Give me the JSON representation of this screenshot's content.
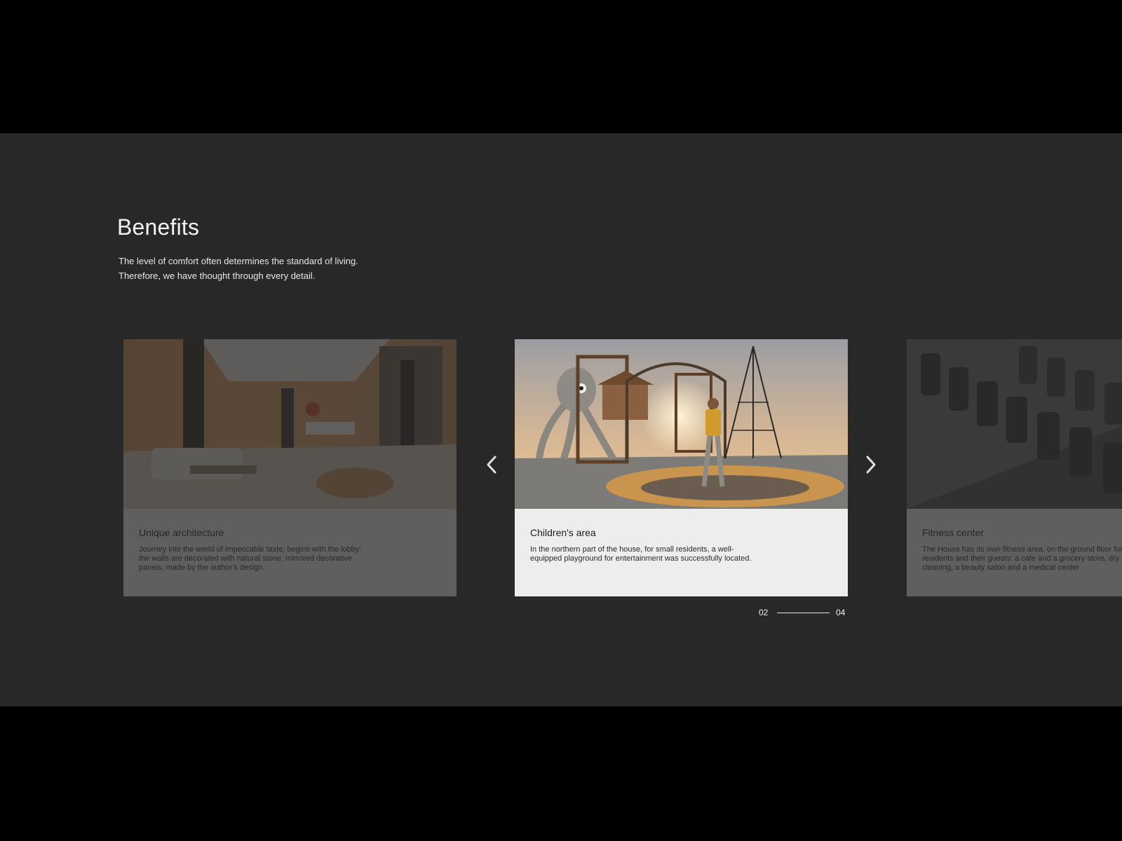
{
  "section": {
    "title": "Benefits",
    "subtitle_lines": [
      "The level of comfort often determines the standard of living.",
      "Therefore, we have thought through every detail."
    ]
  },
  "cards": [
    {
      "title": "Unique architecture",
      "text": "Journey into the world of impeccable taste, begins with the lobby: the walls are decorated with natural stone, mirrored decorative panels, made by the author's design.",
      "image": "lobby-interior-photo",
      "active": false
    },
    {
      "title": "Children's area",
      "text": "In the northern part of the house, for small residents, a well-equipped playground for entertainment was successfully located.",
      "image": "playground-photo",
      "active": true
    },
    {
      "title": "Fitness center",
      "text": "The House has its own fitness area, on the ground floor for residents and their guests: a cafe and a grocery store, dry cleaning, a beauty salon and a medical center",
      "image": "dumbbell-rack-photo",
      "active": false
    }
  ],
  "navigation": {
    "prev_icon": "chevron-left-icon",
    "next_icon": "chevron-right-icon"
  },
  "pager": {
    "current": "02",
    "total": "04"
  },
  "colors": {
    "stage_bg": "#282828",
    "letterbox_bg": "#000000",
    "card_body_bg": "#ededed",
    "text_light": "#f2f2f2"
  }
}
